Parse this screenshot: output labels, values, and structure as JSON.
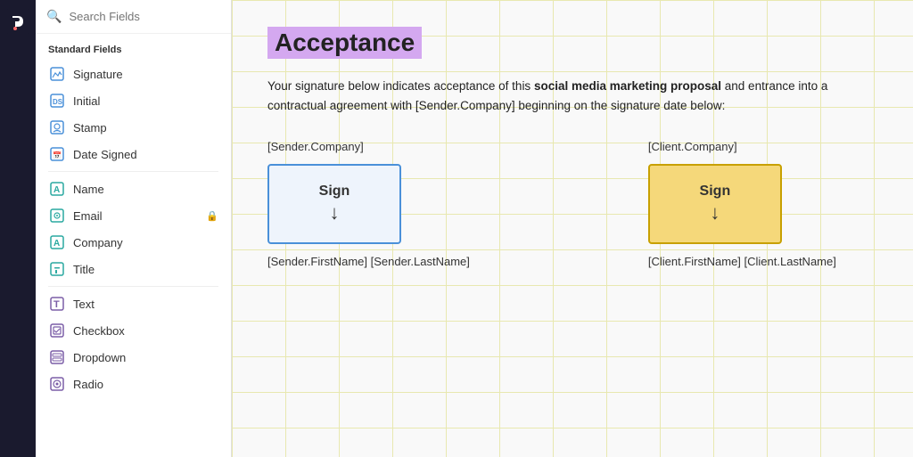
{
  "app": {
    "title": "PandaDoc"
  },
  "sidebar": {
    "search_placeholder": "Search Fields",
    "section_label": "Standard Fields",
    "standard_fields": [
      {
        "id": "signature",
        "label": "Signature",
        "icon": "✏️",
        "icon_type": "blue"
      },
      {
        "id": "initial",
        "label": "Initial",
        "icon": "DS",
        "icon_type": "blue"
      },
      {
        "id": "stamp",
        "label": "Stamp",
        "icon": "👤",
        "icon_type": "blue"
      },
      {
        "id": "date_signed",
        "label": "Date Signed",
        "icon": "📅",
        "icon_type": "blue"
      }
    ],
    "other_fields": [
      {
        "id": "name",
        "label": "Name",
        "icon": "A",
        "icon_type": "teal"
      },
      {
        "id": "email",
        "label": "Email",
        "icon": "◎",
        "icon_type": "teal",
        "locked": true
      },
      {
        "id": "company",
        "label": "Company",
        "icon": "A",
        "icon_type": "teal"
      },
      {
        "id": "title",
        "label": "Title",
        "icon": "🔒",
        "icon_type": "teal"
      }
    ],
    "more_fields": [
      {
        "id": "text",
        "label": "Text",
        "icon": "T",
        "icon_type": "purple"
      },
      {
        "id": "checkbox",
        "label": "Checkbox",
        "icon": "☑",
        "icon_type": "purple"
      },
      {
        "id": "dropdown",
        "label": "Dropdown",
        "icon": "⊟",
        "icon_type": "purple"
      },
      {
        "id": "radio",
        "label": "Radio",
        "icon": "◎",
        "icon_type": "purple"
      }
    ]
  },
  "document": {
    "title": "Acceptance",
    "body_text": "Your signature below indicates acceptance of this ",
    "bold_text": "social media marketing proposal",
    "body_text2": " and entrance into a contractual agreement with [Sender.Company] beginning on the signature date below:",
    "sender_company_label": "[Sender.Company]",
    "client_company_label": "[Client.Company]",
    "sign_label": "Sign",
    "sender_name": "[Sender.FirstName] [Sender.LastName]",
    "client_name": "[Client.FirstName] [Client.LastName]"
  }
}
